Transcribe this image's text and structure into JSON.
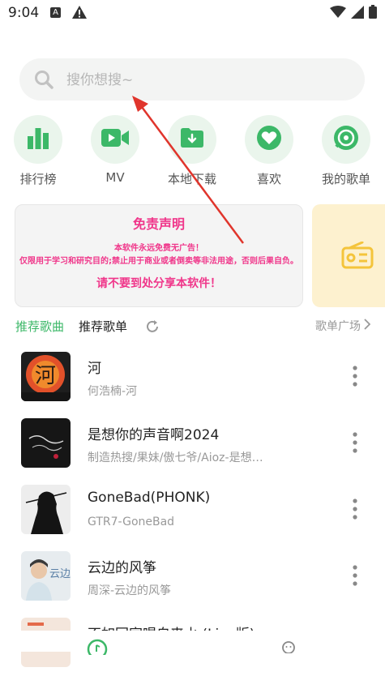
{
  "status": {
    "time": "9:04",
    "a_badge": "A"
  },
  "search": {
    "placeholder": "搜你想搜~"
  },
  "categories": [
    {
      "label": "排行榜",
      "icon": "chart-bars-icon"
    },
    {
      "label": "MV",
      "icon": "video-camera-icon"
    },
    {
      "label": "本地下载",
      "icon": "download-folder-icon"
    },
    {
      "label": "喜欢",
      "icon": "heart-icon"
    },
    {
      "label": "我的歌单",
      "icon": "playlist-disc-icon"
    }
  ],
  "banner": {
    "title": "免责声明",
    "line1": "本软件永远免费无广告！",
    "line2": "仅限用于学习和研究目的;禁止用于商业或者倒卖等非法用途，否则后果自负。",
    "footer": "请不要到处分享本软件！"
  },
  "tabs": {
    "recommend_songs": "推荐歌曲",
    "recommend_lists": "推荐歌单",
    "more": "歌单广场"
  },
  "songs": [
    {
      "title": "河",
      "subtitle": "何浩楠-河"
    },
    {
      "title": "是想你的声音啊2024",
      "subtitle": "制造热搜/果妹/傲七爷/Aioz-是想…"
    },
    {
      "title": "GoneBad(PHONK)",
      "subtitle": "GTR7-GoneBad"
    },
    {
      "title": "云边的风筝",
      "subtitle": "周深-云边的风筝"
    },
    {
      "title": "不如回家喝自来水 (Live版)",
      "subtitle": ""
    }
  ],
  "colors": {
    "accent": "#3cb868",
    "banner_text": "#f0368a",
    "arrow": "#e0352c"
  }
}
